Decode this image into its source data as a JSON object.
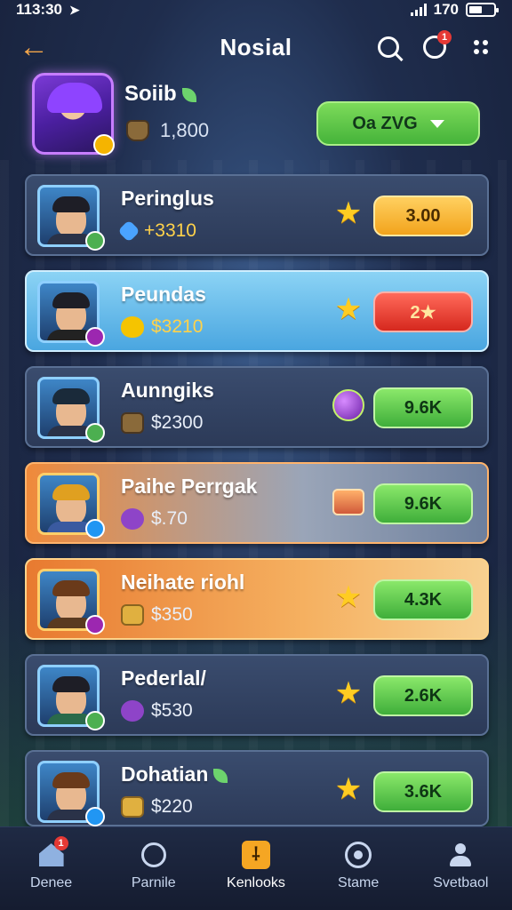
{
  "status_bar": {
    "time": "113:30",
    "carrier": "170"
  },
  "header": {
    "title": "Nosial",
    "notification_count": "1"
  },
  "profile": {
    "name": "Soiib",
    "coins": "1,800",
    "dropdown_label": "Oa ZVG"
  },
  "rows": [
    {
      "name": "Peringlus",
      "sub_value": "+3310",
      "reward_icon": "star-icon",
      "pill_value": "3.00",
      "pill_color": "orange"
    },
    {
      "name": "Peundas",
      "sub_value": "$3210",
      "reward_icon": "star-icon",
      "pill_value": "2★",
      "pill_color": "red"
    },
    {
      "name": "Aunngiks",
      "sub_value": "$2300",
      "reward_icon": "orb-icon",
      "pill_value": "9.6K",
      "pill_color": "green"
    },
    {
      "name": "Paihe Perrgak",
      "sub_value": "$.70",
      "reward_icon": "gift-box-icon",
      "pill_value": "9.6K",
      "pill_color": "green"
    },
    {
      "name": "Neihate riohl",
      "sub_value": "$350",
      "reward_icon": "star-icon",
      "pill_value": "4.3K",
      "pill_color": "green"
    },
    {
      "name": "Pederlal/",
      "sub_value": "$530",
      "reward_icon": "star-icon",
      "pill_value": "2.6K",
      "pill_color": "green"
    },
    {
      "name": "Dohatian",
      "sub_value": "$220",
      "reward_icon": "star-icon",
      "pill_value": "3.6K",
      "pill_color": "green"
    }
  ],
  "bottom_nav": [
    {
      "label": "Denee",
      "icon": "home-icon",
      "badge": "1"
    },
    {
      "label": "Parnile",
      "icon": "chat-icon"
    },
    {
      "label": "Kenlooks",
      "icon": "trophy-icon",
      "active": true
    },
    {
      "label": "Stame",
      "icon": "target-icon"
    },
    {
      "label": "Svetbaol",
      "icon": "profile-icon"
    }
  ]
}
